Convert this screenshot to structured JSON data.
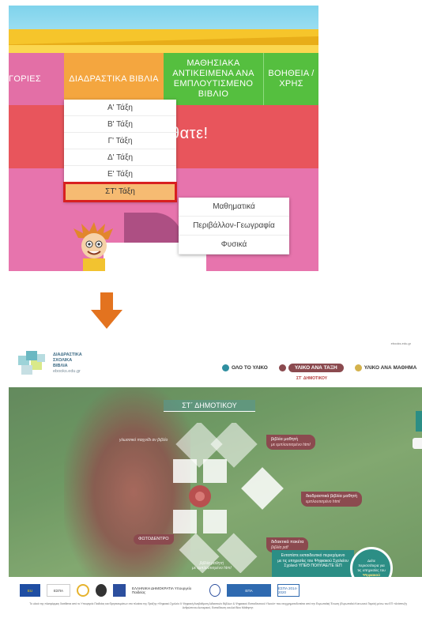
{
  "top_panel": {
    "nav": {
      "categories": "ΓΟΡΙΕΣ",
      "books": "ΔΙΑΔΡΑΣΤΙΚΑ ΒΙΒΛΙΑ",
      "learning": "ΜΑΘΗΣΙΑΚΑ ΑΝΤΙΚΕΙΜΕΝΑ ΑΝΑ ΕΜΠΛΟΥΤΙΣΜΕΝΟ ΒΙΒΛΙΟ",
      "help": "ΒΟΗΘΕΙΑ / ΧΡΗΣ"
    },
    "banner_text": "θατε!",
    "grades": [
      "Α' Τάξη",
      "Β' Τάξη",
      "Γ' Τάξη",
      "Δ' Τάξη",
      "Ε' Τάξη",
      "ΣΤ' Τάξη"
    ],
    "selected_grade": "ΣΤ' Τάξη",
    "subjects": [
      "Μαθηματικά",
      "Περιβάλλον-Γεωγραφία",
      "Φυσικά"
    ]
  },
  "bottom_panel": {
    "logo_text": [
      "ΔΙΑΔΡΑΣΤΙΚΑ",
      "ΣΧΟΛΙΚΑ",
      "ΒΙΒΛΙΑ"
    ],
    "logo_url": "ebooks.edu.gr",
    "top_link": "ebooks.edu.gr",
    "nav": {
      "all": "ΟΛΟ ΤΟ ΥΛΙΚΟ",
      "by_grade": "ΥΛΙΚΟ ΑΝΑ ΤΑΞΗ",
      "by_subject": "ΥΛΙΚΟ ΑΝΑ ΜΑΘΗΜΑ",
      "sub": "ΣΤ΄ ΔΗΜΟΤΙΚΟΥ"
    },
    "colors": {
      "all_dot": "#2f8fa0",
      "grade_dot": "#8b4a4f",
      "subject_dot": "#d4b24c"
    },
    "grade_title": "ΣΤ΄ ΔΗΜΟΤΙΚΟΥ",
    "labels": {
      "student_book": "βιβλία μαθητή",
      "student_book_sub": "με εμπλουτισμένο html",
      "interactive_book": "διαδραστικά βιβλία μαθητή",
      "interactive_book_sub": "εμπλουτισμένο html",
      "photodendro": "ΦΩΤΟΔΕΝΤΡΟ",
      "teacher_pack": "διδακτικά πακέτα",
      "teacher_pack_sub": "βιβλία pdf",
      "faint_top": "γλωσσικό παιχνίδι αν βιβλίο",
      "faint_bottom_a": "βιβλία μαθητή",
      "faint_bottom_b": "με εμπλουτισμένο html"
    },
    "promo": [
      "Εντοπίστε εκπαιδευτικό περιεχόμενο",
      "με τις υπηρεσίες του Ψηφιακού Σχολείου",
      "Σχολικό ΥΠΕΘ ΠΟΛΥ/ΑΕ/ΤΕ ΙΕΠ"
    ],
    "circle": [
      "Δείτε",
      "περισσότερα για",
      "τις υπηρεσίες του",
      "Ψηφιακού",
      "Σχολείου"
    ],
    "footer_logos": [
      "EU",
      "ΕΣΠΑ",
      "ΕΛΛΗΝΙΚΗ ΔΗΜΟΚΡΑΤΙΑ Υπουργείο Παιδείας",
      "ΕΠΑ",
      "ΕΣΠΑ 2014-2020"
    ],
    "fine_print": "Το υλικό της πλατφόρμας διατίθεται από το Υπουργείο Παιδείας και Θρησκευμάτων στο πλαίσιο της Πράξης «Ψηφιακό Σχολείο ΙΙ: Ψηφιακή Αναβάθμιση Διδακτικών Βιβλίων & Ψηφιακού Εκπαιδευτικού Υλικού» που συγχρηματοδοτείται από την Ευρωπαϊκή Ένωση (Ευρωπαϊκό Κοινωνικό Ταμείο) μέσω του ΕΠ «Ανάπτυξη Ανθρώπινου Δυναμικού, Εκπαίδευση και Διά Βίου Μάθηση»."
  }
}
